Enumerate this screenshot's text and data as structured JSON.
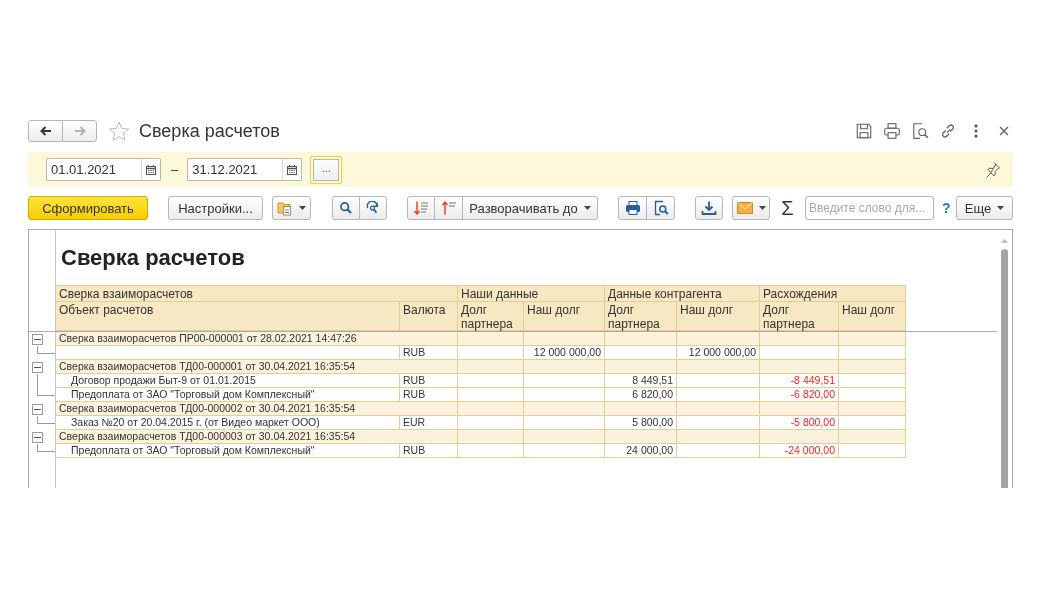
{
  "window": {
    "title": "Сверка расчетов",
    "favorite": false,
    "navigation": [
      {
        "kind": "back",
        "disabled": false
      },
      {
        "kind": "forward",
        "disabled": true
      }
    ]
  },
  "period": {
    "start": "01.01.2021",
    "separator": "–",
    "end": "31.12.2021",
    "choose_button": {
      "label": "...",
      "focused": true
    }
  },
  "toolbar": {
    "generate_button": "Сформировать",
    "settings_button": "Настройки...",
    "expand_button": "Разворачивать до",
    "sum_button": "Σ",
    "search": {
      "placeholder": "Введите слово для..."
    },
    "help_link": "?",
    "more_button": "Еще"
  },
  "report": {
    "title": "Сверка расчетов",
    "column_groups": [
      {
        "label": "Сверка взаиморасчетов",
        "kind": "text",
        "columns": [
          {
            "label": "Объект расчетов"
          },
          {
            "label": "Валюта"
          }
        ]
      },
      {
        "label": "Наши данные",
        "kind": "amount",
        "columns": [
          {
            "label": "Долг партнера"
          },
          {
            "label": "Наш долг"
          }
        ]
      },
      {
        "label": "Данные контрагента",
        "kind": "amount",
        "columns": [
          {
            "label": "Долг партнера"
          },
          {
            "label": "Наш долг"
          }
        ]
      },
      {
        "label": "Расхождения",
        "kind": "discrepancy",
        "columns": [
          {
            "label": "Долг партнера"
          },
          {
            "label": "Наш долг"
          }
        ]
      }
    ],
    "groups": [
      {
        "label": "Сверка взаиморасчетов ПР00-000001 от 28.02.2021 14:47:26",
        "expanded": true,
        "children": [
          {
            "currency": "RUB",
            "our_our_debt": "12 000 000,00",
            "counterparty_our_debt": "12 000 000,00"
          }
        ]
      },
      {
        "label": "Сверка взаиморасчетов ТД00-000001 от 30.04.2021 16:35:54",
        "expanded": true,
        "children": [
          {
            "object": "Договор продажи Быт-9 от 01.01.2015",
            "currency": "RUB",
            "counterparty_partner_debt": "8 449,51",
            "discrepancy_partner_debt": "-8 449,51"
          },
          {
            "object": "Предоплата от ЗАО \"Торговый дом Комплексный\"",
            "currency": "RUB",
            "counterparty_partner_debt": "6 820,00",
            "discrepancy_partner_debt": "-6 820,00"
          }
        ]
      },
      {
        "label": "Сверка взаиморасчетов ТД00-000002 от 30.04.2021 16:35:54",
        "expanded": true,
        "children": [
          {
            "object": "Заказ №20 от 20.04.2015 г. (от Видео маркет ООО)",
            "currency": "EUR",
            "counterparty_partner_debt": "5 800,00",
            "discrepancy_partner_debt": "-5 800,00"
          }
        ]
      },
      {
        "label": "Сверка взаиморасчетов ТД00-000003 от 30.04.2021 16:35:54",
        "expanded": true,
        "children": [
          {
            "object": "Предоплата от ЗАО \"Торговый дом Комплексный\"",
            "currency": "RUB",
            "counterparty_partner_debt": "24 000,00",
            "discrepancy_partner_debt": "-24 000,00"
          }
        ]
      }
    ]
  }
}
